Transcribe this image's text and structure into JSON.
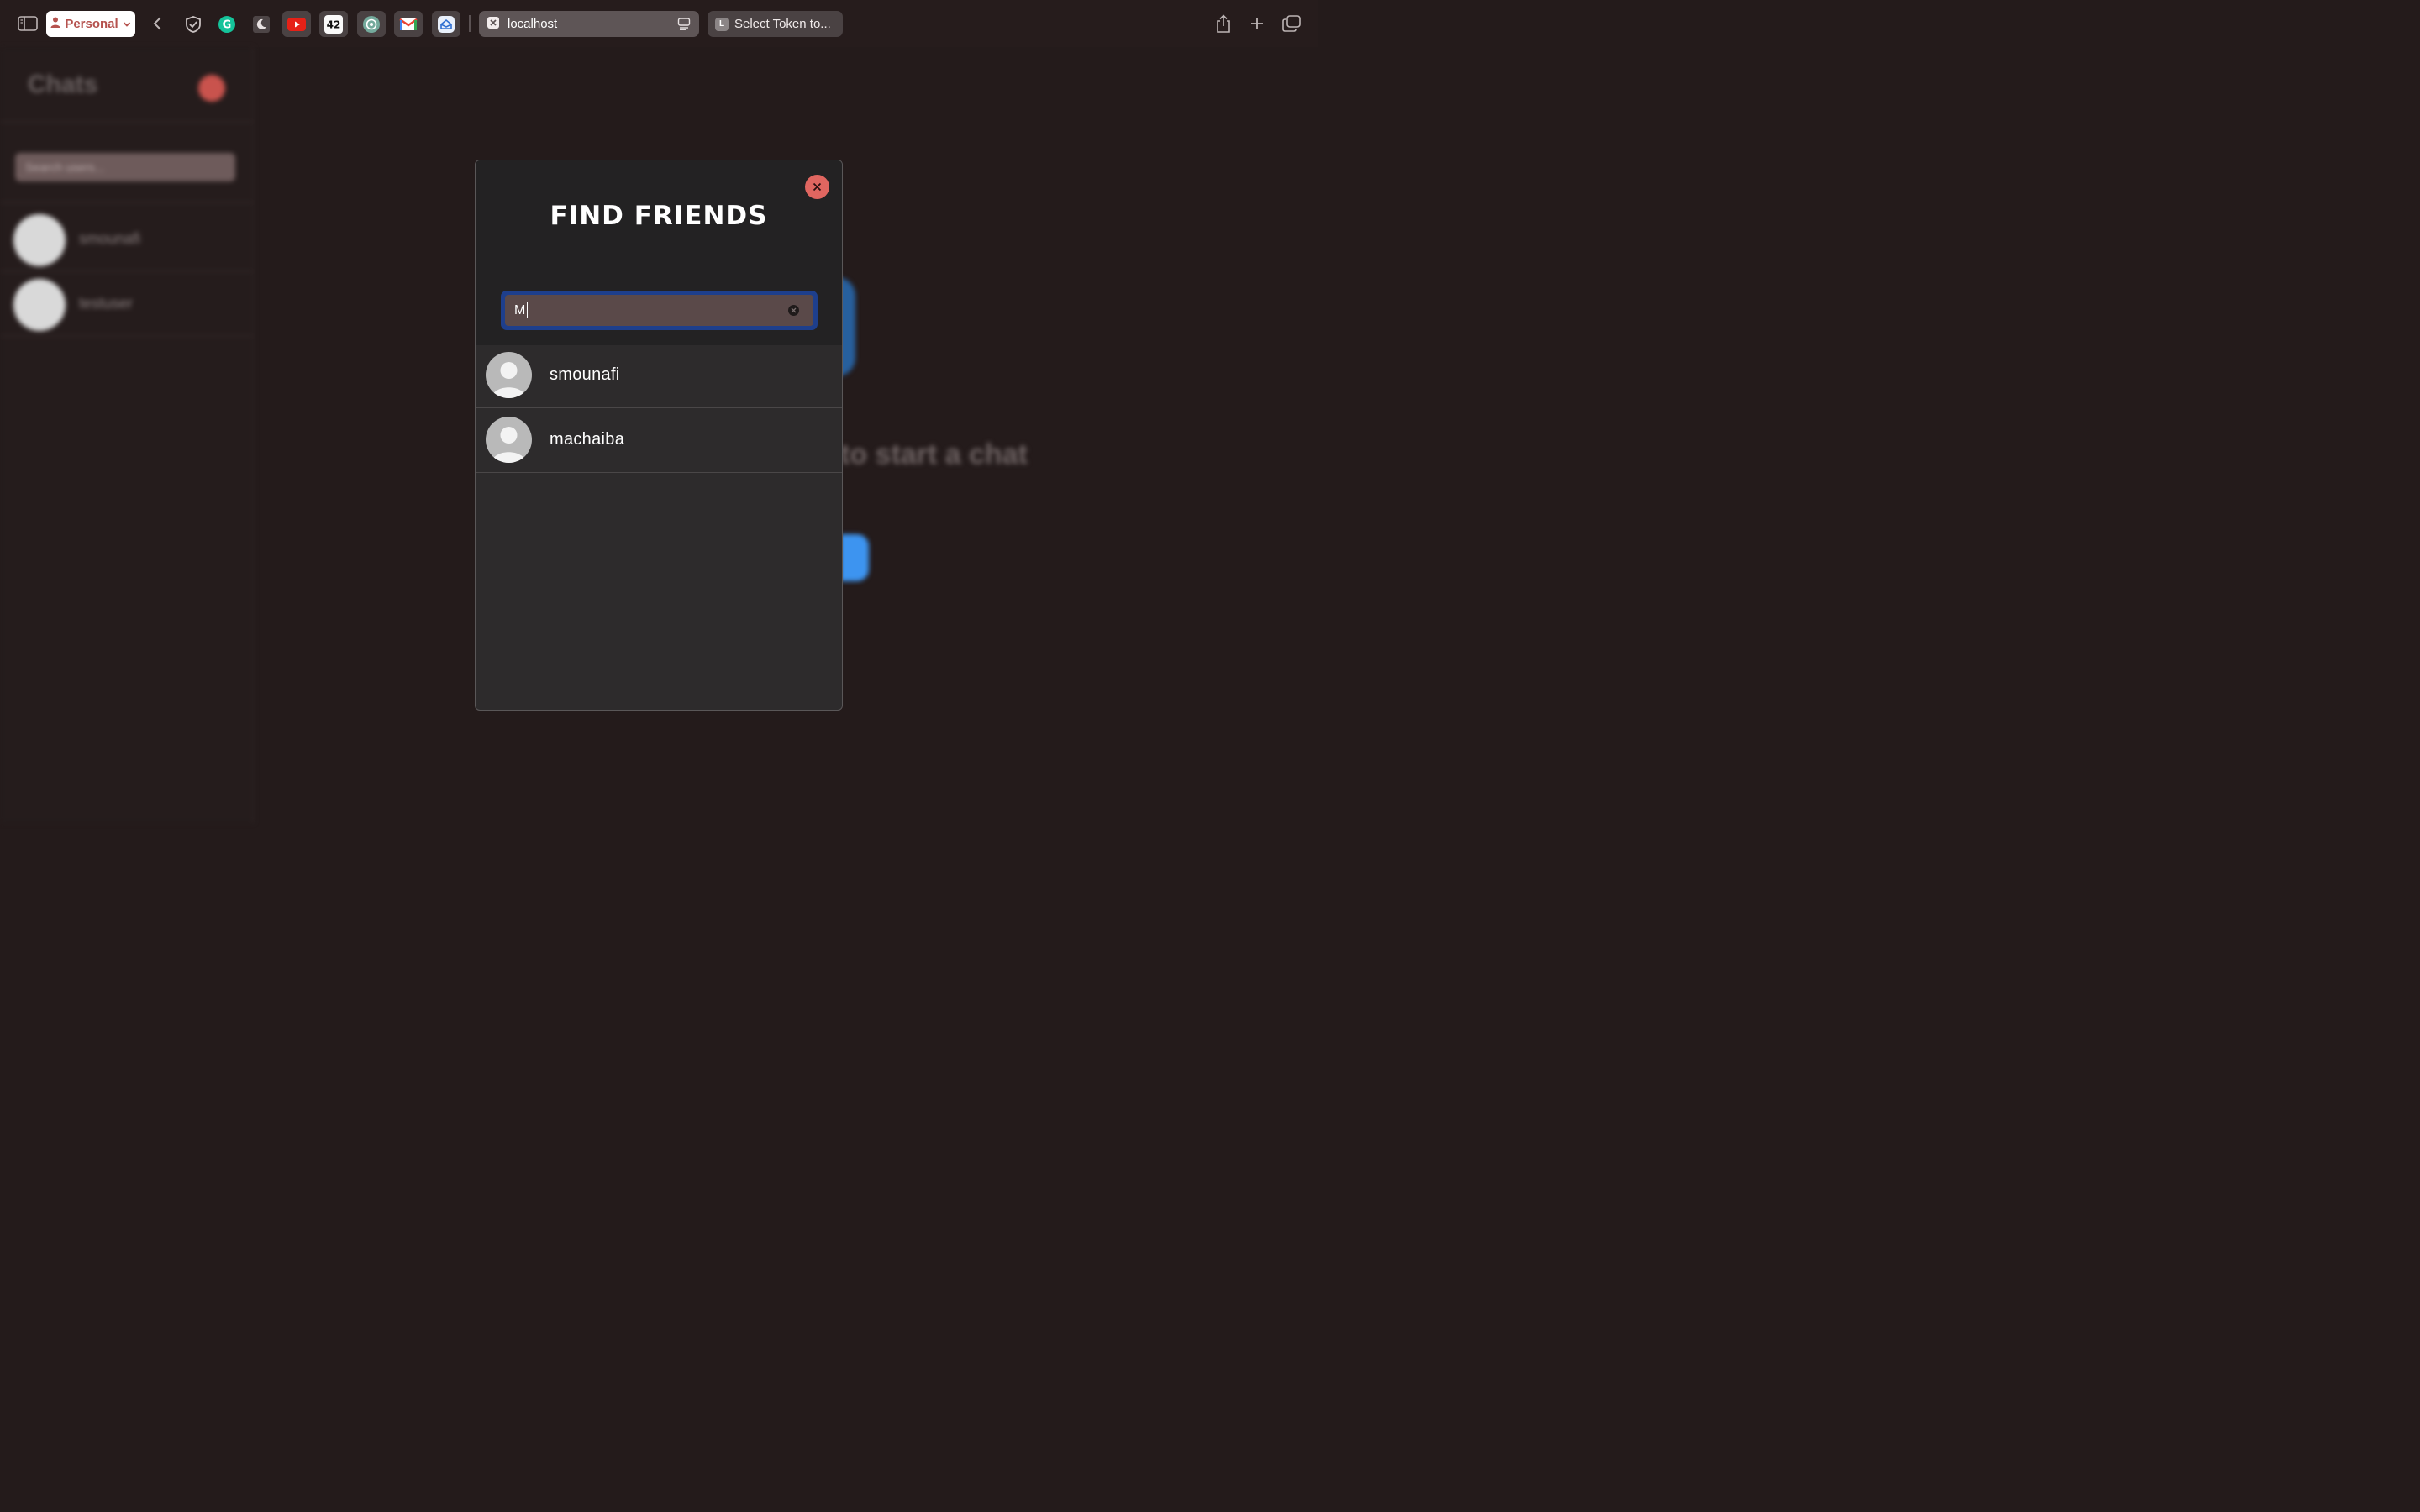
{
  "browser": {
    "profile_label": "Personal",
    "url": "localhost",
    "second_tab_label": "Select Token to...",
    "second_tab_favicon_letter": "L",
    "extensions": [
      "shield-icon",
      "grammarly-icon",
      "dark-mode-icon",
      "youtube-icon",
      "42-icon",
      "chatgpt-icon",
      "gmail-icon",
      "mail-icon"
    ]
  },
  "background_app": {
    "title": "Chats",
    "search_placeholder": "Search users...",
    "chats": [
      {
        "name": "smounafi"
      },
      {
        "name": "testuser"
      }
    ],
    "main_prompt": "to start a chat"
  },
  "modal": {
    "title": "FIND FRIENDS",
    "search_value": "M",
    "results": [
      {
        "name": "smounafi"
      },
      {
        "name": "machaiba"
      }
    ]
  },
  "colors": {
    "background": "#241b1b",
    "modal_bg": "#2d2b2c",
    "close_button": "#e06660",
    "input_focus_ring": "#1e3f8c",
    "input_bg": "#5a4949",
    "profile_text": "#b5524e"
  }
}
